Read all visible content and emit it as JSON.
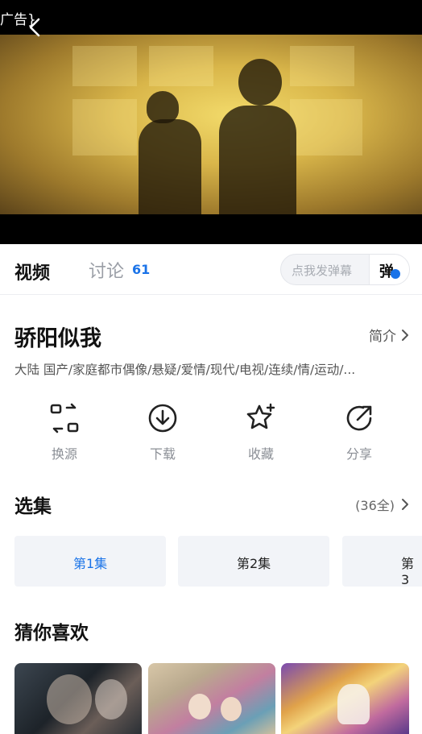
{
  "video": {
    "ad_label": "广告}"
  },
  "tabs": {
    "video_label": "视频",
    "discuss_label": "讨论",
    "discuss_count": "61",
    "danmu_placeholder": "点我发弹幕",
    "danmu_button": "弹"
  },
  "show": {
    "title": "骄阳似我",
    "intro_label": "简介",
    "tags": "大陆  国产/家庭都市偶像/悬疑/爱情/现代/电视/连续/情/运动/..."
  },
  "actions": [
    {
      "label": "换源",
      "icon": "switch-source-icon"
    },
    {
      "label": "下载",
      "icon": "download-icon"
    },
    {
      "label": "收藏",
      "icon": "favorite-star-icon"
    },
    {
      "label": "分享",
      "icon": "share-icon"
    }
  ],
  "episodes": {
    "title": "选集",
    "total": "(36全)",
    "items": [
      "第1集",
      "第2集",
      "第3"
    ]
  },
  "recommend": {
    "title": "猜你喜欢"
  },
  "colors": {
    "accent": "#1a73e8",
    "episode_bg": "#f2f4f8"
  }
}
